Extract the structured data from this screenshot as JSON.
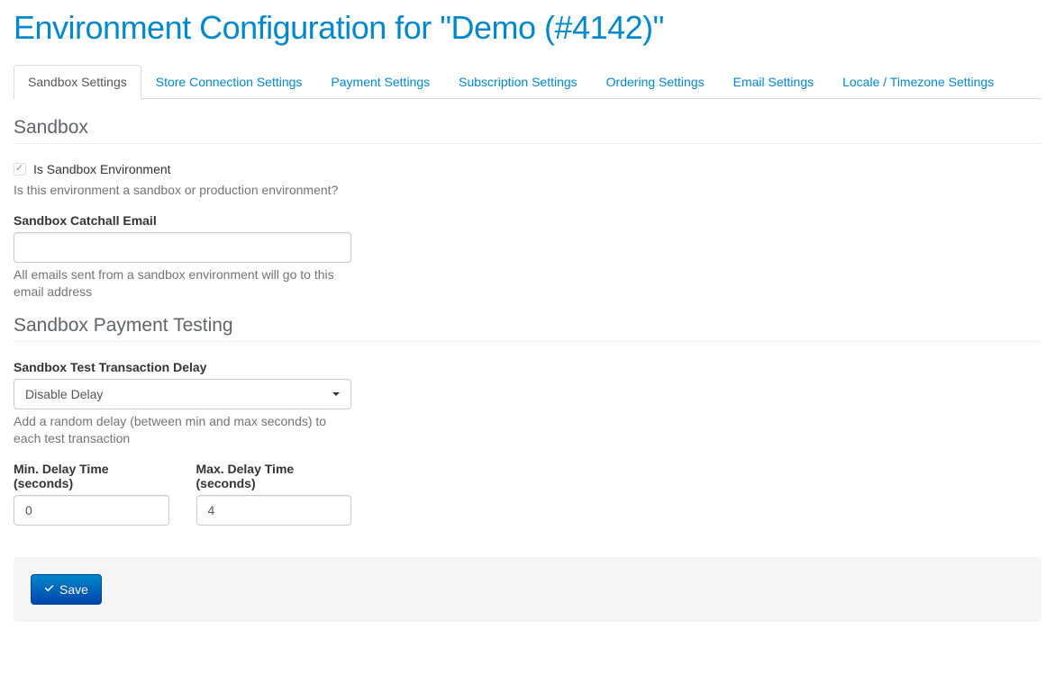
{
  "page": {
    "title": "Environment Configuration for \"Demo (#4142)\""
  },
  "tabs": [
    {
      "label": "Sandbox Settings",
      "active": true
    },
    {
      "label": "Store Connection Settings",
      "active": false
    },
    {
      "label": "Payment Settings",
      "active": false
    },
    {
      "label": "Subscription Settings",
      "active": false
    },
    {
      "label": "Ordering Settings",
      "active": false
    },
    {
      "label": "Email Settings",
      "active": false
    },
    {
      "label": "Locale / Timezone Settings",
      "active": false
    }
  ],
  "sections": {
    "sandbox": {
      "heading": "Sandbox",
      "is_sandbox": {
        "checked": true,
        "label": "Is Sandbox Environment",
        "help": "Is this environment a sandbox or production environment?"
      },
      "catchall": {
        "label": "Sandbox Catchall Email",
        "value": "",
        "help": "All emails sent from a sandbox environment will go to this email address"
      }
    },
    "payment_testing": {
      "heading": "Sandbox Payment Testing",
      "delay": {
        "label": "Sandbox Test Transaction Delay",
        "selected": "Disable Delay",
        "help": "Add a random delay (between min and max seconds) to each test transaction"
      },
      "min_delay": {
        "label": "Min. Delay Time (seconds)",
        "value": "0"
      },
      "max_delay": {
        "label": "Max. Delay Time (seconds)",
        "value": "4"
      }
    }
  },
  "footer": {
    "save_label": "Save"
  }
}
